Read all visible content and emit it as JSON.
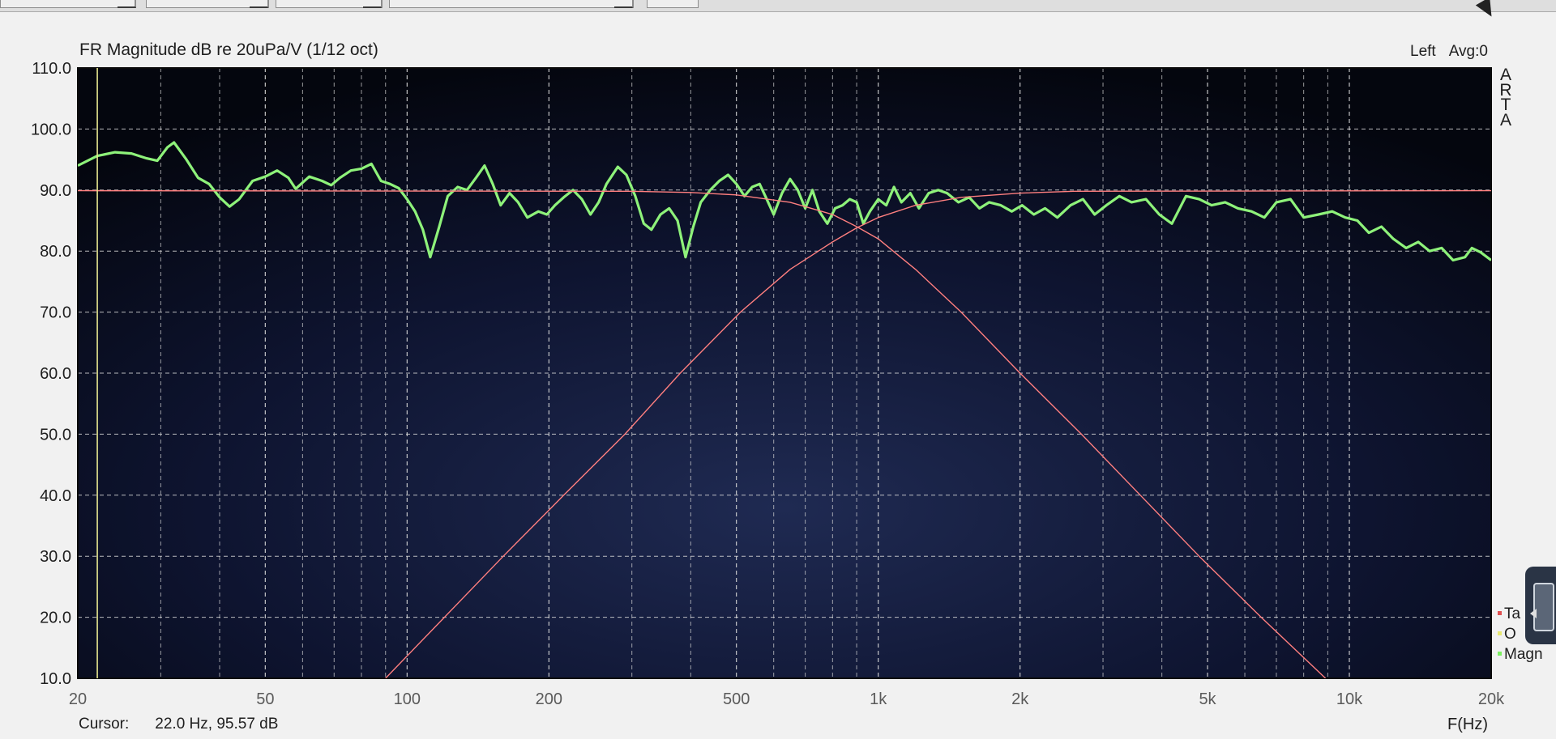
{
  "window": {
    "title": "FR Magnitude dB re 20uPa/V (1/12 oct)",
    "channel": "Left",
    "avg": "Avg:0",
    "brand_letters": [
      "A",
      "R",
      "T",
      "A"
    ]
  },
  "status": {
    "cursor_label": "Cursor:",
    "cursor_value": "22.0 Hz, 95.57 dB"
  },
  "legend": [
    {
      "label": "Ta",
      "color": "#e05050"
    },
    {
      "label": "O",
      "color": "#e8e870"
    },
    {
      "label": "Magn",
      "color": "#7cf060"
    }
  ],
  "icons": {
    "mouse_cursor": "mouse-cursor-icon",
    "side_panel": "side-panel-icon",
    "side_tab": "chevron-left-icon"
  },
  "colors": {
    "plot_background": "#04060e",
    "grid": "#d8d8d8",
    "magnitude": "#8ef27a",
    "target": "#ff7f7f",
    "cursor_line": "#e8e890"
  },
  "chart_data": {
    "type": "line",
    "title": "FR Magnitude dB re 20uPa/V (1/12 oct)",
    "xlabel": "F(Hz)",
    "ylabel": "",
    "x_scale": "log",
    "xlim": [
      20,
      20000
    ],
    "ylim": [
      10,
      110
    ],
    "grid": true,
    "legend_position": "right-bottom",
    "y_ticks": [
      "110.0",
      "100.0",
      "90.0",
      "80.0",
      "70.0",
      "60.0",
      "50.0",
      "40.0",
      "30.0",
      "20.0",
      "10.0"
    ],
    "y_tick_values": [
      110,
      100,
      90,
      80,
      70,
      60,
      50,
      40,
      30,
      20,
      10
    ],
    "x_ticks": [
      {
        "value": 20,
        "label": "20"
      },
      {
        "value": 50,
        "label": "50"
      },
      {
        "value": 100,
        "label": "100"
      },
      {
        "value": 200,
        "label": "200"
      },
      {
        "value": 500,
        "label": "500"
      },
      {
        "value": 1000,
        "label": "1k"
      },
      {
        "value": 2000,
        "label": "2k"
      },
      {
        "value": 5000,
        "label": "5k"
      },
      {
        "value": 10000,
        "label": "10k"
      },
      {
        "value": 20000,
        "label": "20k"
      }
    ],
    "cursor": {
      "x": 22.0,
      "y": 95.57
    },
    "series": [
      {
        "name": "Magn",
        "color": "#8ef27a",
        "points": [
          [
            20,
            94.0
          ],
          [
            22,
            95.6
          ],
          [
            24,
            96.2
          ],
          [
            26,
            96.0
          ],
          [
            28,
            95.2
          ],
          [
            29.5,
            94.8
          ],
          [
            31,
            97.0
          ],
          [
            32,
            97.8
          ],
          [
            34,
            95.0
          ],
          [
            36,
            92.0
          ],
          [
            38,
            91.0
          ],
          [
            40,
            88.8
          ],
          [
            42,
            87.3
          ],
          [
            44,
            88.5
          ],
          [
            47,
            91.5
          ],
          [
            50,
            92.2
          ],
          [
            53,
            93.2
          ],
          [
            56,
            92.0
          ],
          [
            58,
            90.2
          ],
          [
            62,
            92.2
          ],
          [
            66,
            91.5
          ],
          [
            69,
            90.8
          ],
          [
            72,
            92.0
          ],
          [
            76,
            93.2
          ],
          [
            80,
            93.5
          ],
          [
            84,
            94.3
          ],
          [
            88,
            91.5
          ],
          [
            92,
            91.0
          ],
          [
            96,
            90.3
          ],
          [
            100,
            88.5
          ],
          [
            104,
            86.5
          ],
          [
            108,
            83.5
          ],
          [
            112,
            79.0
          ],
          [
            117,
            84.0
          ],
          [
            122,
            89.0
          ],
          [
            128,
            90.5
          ],
          [
            134,
            90.0
          ],
          [
            140,
            92.0
          ],
          [
            146,
            94.0
          ],
          [
            152,
            91.0
          ],
          [
            158,
            87.5
          ],
          [
            165,
            89.5
          ],
          [
            172,
            88.0
          ],
          [
            180,
            85.5
          ],
          [
            190,
            86.5
          ],
          [
            198,
            86.0
          ],
          [
            206,
            87.5
          ],
          [
            215,
            88.8
          ],
          [
            225,
            90.0
          ],
          [
            235,
            88.5
          ],
          [
            245,
            86.0
          ],
          [
            255,
            88.0
          ],
          [
            265,
            91.0
          ],
          [
            280,
            93.8
          ],
          [
            292,
            92.5
          ],
          [
            305,
            89.0
          ],
          [
            318,
            84.5
          ],
          [
            330,
            83.5
          ],
          [
            345,
            86.0
          ],
          [
            360,
            87.0
          ],
          [
            375,
            85.0
          ],
          [
            390,
            79.0
          ],
          [
            405,
            84.0
          ],
          [
            420,
            88.0
          ],
          [
            440,
            90.0
          ],
          [
            460,
            91.5
          ],
          [
            480,
            92.5
          ],
          [
            500,
            91.0
          ],
          [
            520,
            89.0
          ],
          [
            540,
            90.5
          ],
          [
            560,
            91.0
          ],
          [
            580,
            88.5
          ],
          [
            600,
            86.0
          ],
          [
            625,
            89.5
          ],
          [
            650,
            91.8
          ],
          [
            675,
            90.0
          ],
          [
            700,
            87.0
          ],
          [
            725,
            90.0
          ],
          [
            750,
            86.5
          ],
          [
            780,
            84.5
          ],
          [
            810,
            87.0
          ],
          [
            840,
            87.5
          ],
          [
            870,
            88.5
          ],
          [
            900,
            88.0
          ],
          [
            930,
            84.5
          ],
          [
            960,
            86.5
          ],
          [
            1000,
            88.5
          ],
          [
            1040,
            87.5
          ],
          [
            1080,
            90.5
          ],
          [
            1120,
            88.0
          ],
          [
            1170,
            89.5
          ],
          [
            1220,
            87.0
          ],
          [
            1280,
            89.5
          ],
          [
            1340,
            90.0
          ],
          [
            1400,
            89.5
          ],
          [
            1480,
            88.0
          ],
          [
            1560,
            88.8
          ],
          [
            1640,
            87.0
          ],
          [
            1720,
            88.0
          ],
          [
            1820,
            87.5
          ],
          [
            1920,
            86.5
          ],
          [
            2020,
            87.5
          ],
          [
            2140,
            86.0
          ],
          [
            2260,
            87.0
          ],
          [
            2400,
            85.5
          ],
          [
            2560,
            87.5
          ],
          [
            2720,
            88.5
          ],
          [
            2880,
            86.0
          ],
          [
            3050,
            87.5
          ],
          [
            3250,
            89.0
          ],
          [
            3450,
            88.0
          ],
          [
            3700,
            88.5
          ],
          [
            3950,
            86.0
          ],
          [
            4200,
            84.5
          ],
          [
            4500,
            89.0
          ],
          [
            4800,
            88.5
          ],
          [
            5100,
            87.5
          ],
          [
            5450,
            88.0
          ],
          [
            5800,
            87.0
          ],
          [
            6200,
            86.5
          ],
          [
            6600,
            85.5
          ],
          [
            7000,
            88.0
          ],
          [
            7500,
            88.5
          ],
          [
            8000,
            85.5
          ],
          [
            8600,
            86.0
          ],
          [
            9200,
            86.5
          ],
          [
            9800,
            85.5
          ],
          [
            10400,
            85.0
          ],
          [
            11000,
            83.0
          ],
          [
            11700,
            84.0
          ],
          [
            12400,
            82.0
          ],
          [
            13200,
            80.5
          ],
          [
            14000,
            81.5
          ],
          [
            14800,
            80.0
          ],
          [
            15700,
            80.5
          ],
          [
            16600,
            78.5
          ],
          [
            17600,
            79.0
          ],
          [
            18200,
            80.5
          ],
          [
            19000,
            79.8
          ],
          [
            20000,
            78.5
          ]
        ]
      },
      {
        "name": "Target high-pass",
        "color": "#ff7f7f",
        "points": [
          [
            90,
            10.0
          ],
          [
            120,
            20.0
          ],
          [
            160,
            30.0
          ],
          [
            215,
            40.0
          ],
          [
            290,
            50.0
          ],
          [
            380,
            60.0
          ],
          [
            510,
            70.0
          ],
          [
            650,
            77.0
          ],
          [
            800,
            81.5
          ],
          [
            900,
            83.8
          ],
          [
            1000,
            85.5
          ],
          [
            1200,
            87.5
          ],
          [
            1500,
            88.8
          ],
          [
            2000,
            89.5
          ],
          [
            2600,
            89.8
          ],
          [
            20000,
            89.9
          ]
        ]
      },
      {
        "name": "Target low-pass",
        "color": "#ff7f7f",
        "points": [
          [
            20,
            89.9
          ],
          [
            300,
            89.8
          ],
          [
            400,
            89.6
          ],
          [
            500,
            89.2
          ],
          [
            650,
            88.0
          ],
          [
            800,
            86.0
          ],
          [
            900,
            84.0
          ],
          [
            1000,
            82.0
          ],
          [
            1200,
            77.0
          ],
          [
            1500,
            70.0
          ],
          [
            2000,
            60.0
          ],
          [
            2700,
            50.0
          ],
          [
            3600,
            40.0
          ],
          [
            4800,
            30.0
          ],
          [
            6500,
            20.0
          ],
          [
            8900,
            10.0
          ]
        ]
      }
    ]
  }
}
